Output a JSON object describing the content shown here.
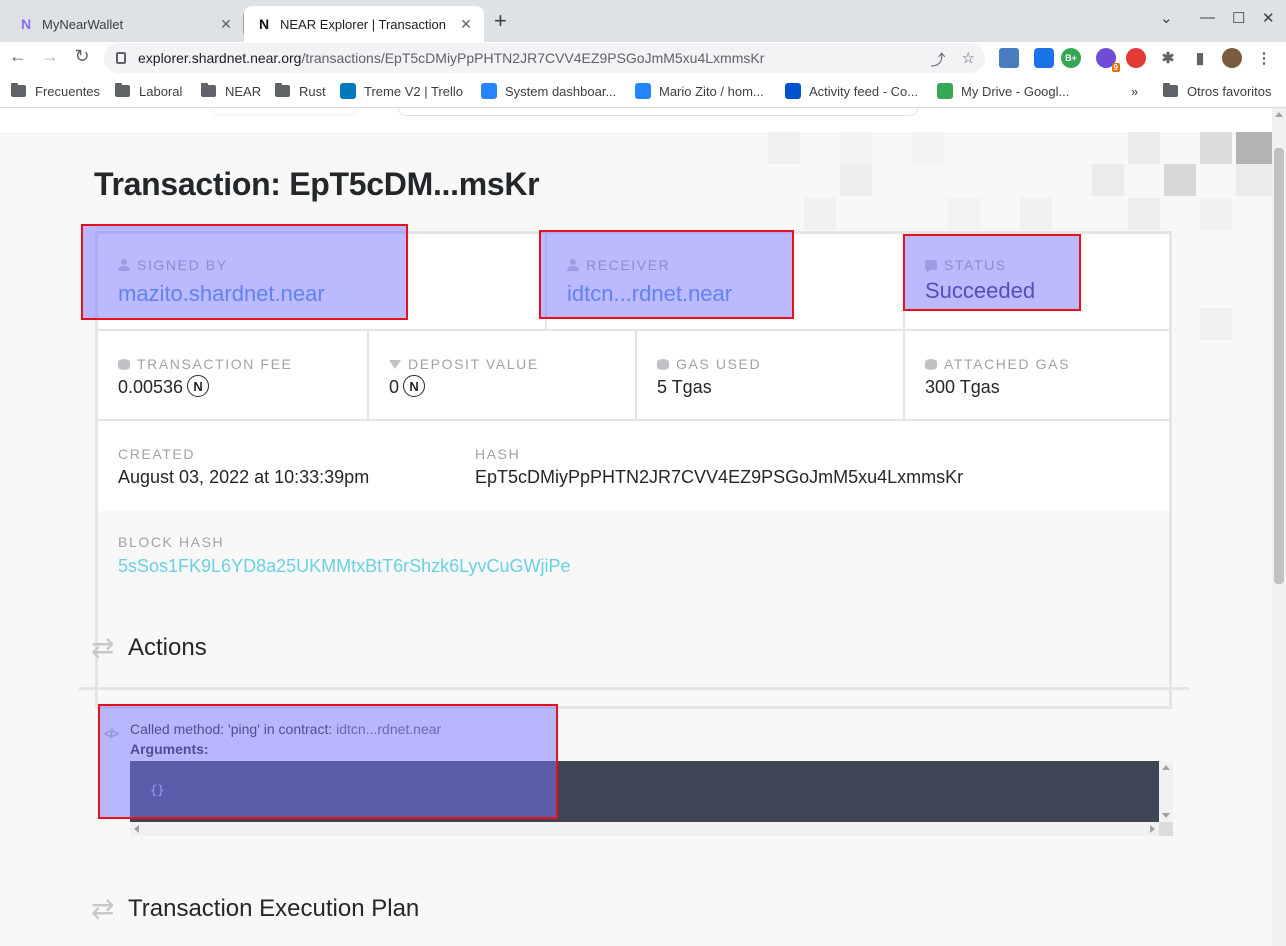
{
  "browser": {
    "tabs": [
      {
        "title": "MyNearWallet",
        "favicon": "near-wallet-icon"
      },
      {
        "title": "NEAR Explorer | Transaction",
        "favicon": "near-icon",
        "active": true
      }
    ],
    "url_host": "explorer.shardnet.near.org",
    "url_path": "/transactions/EpT5cDMiyPpPHTN2JR7CVV4EZ9PSGoJmM5xu4LxmmsKr",
    "bookmarks": [
      "Frecuentes",
      "Laboral",
      "NEAR",
      "Rust",
      "Treme V2 | Trello",
      "System dashboar...",
      "Mario Zito / hom...",
      "Activity feed - Co...",
      "My Drive - Googl..."
    ],
    "other_bookmarks": "Otros favoritos",
    "extension_badge": "9",
    "extension_b_label": "B+"
  },
  "page": {
    "title": "Transaction: EpT5cDM...msKr",
    "signed_by": {
      "label": "SIGNED BY",
      "value": "mazito.shardnet.near"
    },
    "receiver": {
      "label": "RECEIVER",
      "value": "idtcn...rdnet.near"
    },
    "status": {
      "label": "STATUS",
      "value": "Succeeded"
    },
    "transaction_fee": {
      "label": "TRANSACTION FEE",
      "value": "0.00536"
    },
    "deposit_value": {
      "label": "DEPOSIT VALUE",
      "value": "0"
    },
    "gas_used": {
      "label": "GAS USED",
      "value": "5 Tgas"
    },
    "attached_gas": {
      "label": "ATTACHED GAS",
      "value": "300 Tgas"
    },
    "created": {
      "label": "CREATED",
      "value": "August 03, 2022 at 10:33:39pm"
    },
    "hash": {
      "label": "HASH",
      "value": "EpT5cDMiyPpPHTN2JR7CVV4EZ9PSGoJmM5xu4LxmmsKr"
    },
    "block_hash": {
      "label": "BLOCK HASH",
      "value": "5sSos1FK9L6YD8a25UKMMtxBtT6rShzk6LyvCuGWjiPe"
    },
    "near_symbol": "N",
    "actions": {
      "heading": "Actions",
      "method_prefix": "Called method: 'ping' in contract: ",
      "contract": "idtcn...rdnet.near",
      "arguments_label": "Arguments:",
      "code": "{}"
    },
    "execution_plan_heading": "Transaction Execution Plan"
  },
  "colors": {
    "link": "#4a90e2",
    "status": "#2b2f73",
    "block_hash": "#6ad1e3",
    "highlight_border": "#e8101a",
    "highlight_fill": "rgba(120,115,255,0.5)"
  }
}
